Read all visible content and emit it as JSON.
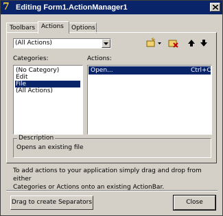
{
  "window": {
    "title": "Editing Form1.ActionManager1"
  },
  "tabs": [
    {
      "label": "Toolbars"
    },
    {
      "label": "Actions"
    },
    {
      "label": "Options"
    }
  ],
  "filter": {
    "selected": "(All Actions)"
  },
  "categories": {
    "label": "Categories:",
    "items": [
      "(No Category)",
      "Edit",
      "File",
      "(All Actions)"
    ],
    "selected_index": 2
  },
  "actions": {
    "label": "Actions:",
    "row": {
      "name": "Open...",
      "shortcut": "Ctrl+O"
    }
  },
  "description": {
    "label": "Description",
    "text": "Opens an existing file"
  },
  "hint": {
    "line1": "To add actions to your application simply drag and drop from either",
    "line2": "Categories or Actions onto an existing ActionBar."
  },
  "buttons": {
    "separators": "Drag to create Separators",
    "close": "Close"
  },
  "colors": {
    "title_bar": "#0a246a",
    "face": "#d4d0c8",
    "selection": "#0a246a"
  }
}
